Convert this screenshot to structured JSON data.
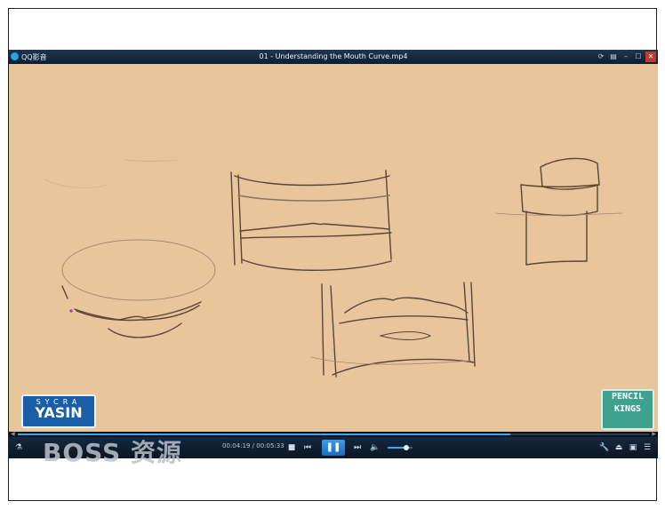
{
  "window": {
    "app_name": "QQ影音",
    "title": "01 - Understanding the Mouth Curve.mp4",
    "buttons": [
      "⟳",
      "▤",
      "–",
      "☐",
      "✕"
    ]
  },
  "video": {
    "overlay_left": {
      "line1": "SYCRA",
      "line2": "YASIN"
    },
    "overlay_right": {
      "line1": "PENCIL",
      "line2": "KINGS"
    }
  },
  "playback": {
    "current_time": "00:04:19",
    "separator": " / ",
    "total_time": "00:05:33",
    "progress_fraction": 0.78,
    "volume_fraction": 0.75
  },
  "controls": {
    "stop": "■",
    "prev": "⏮",
    "play_pause": "❚❚",
    "next": "⏭",
    "volume": "🔈",
    "tool": "🔧",
    "eject": "⏏",
    "screen": "▣",
    "menu": "☰",
    "left_icon": "⚗"
  },
  "watermark": {
    "text": "BOSS 资源"
  },
  "colors": {
    "accent": "#3aa6ee",
    "paper": "#e8c59b",
    "bar": "#0d1b2b"
  }
}
